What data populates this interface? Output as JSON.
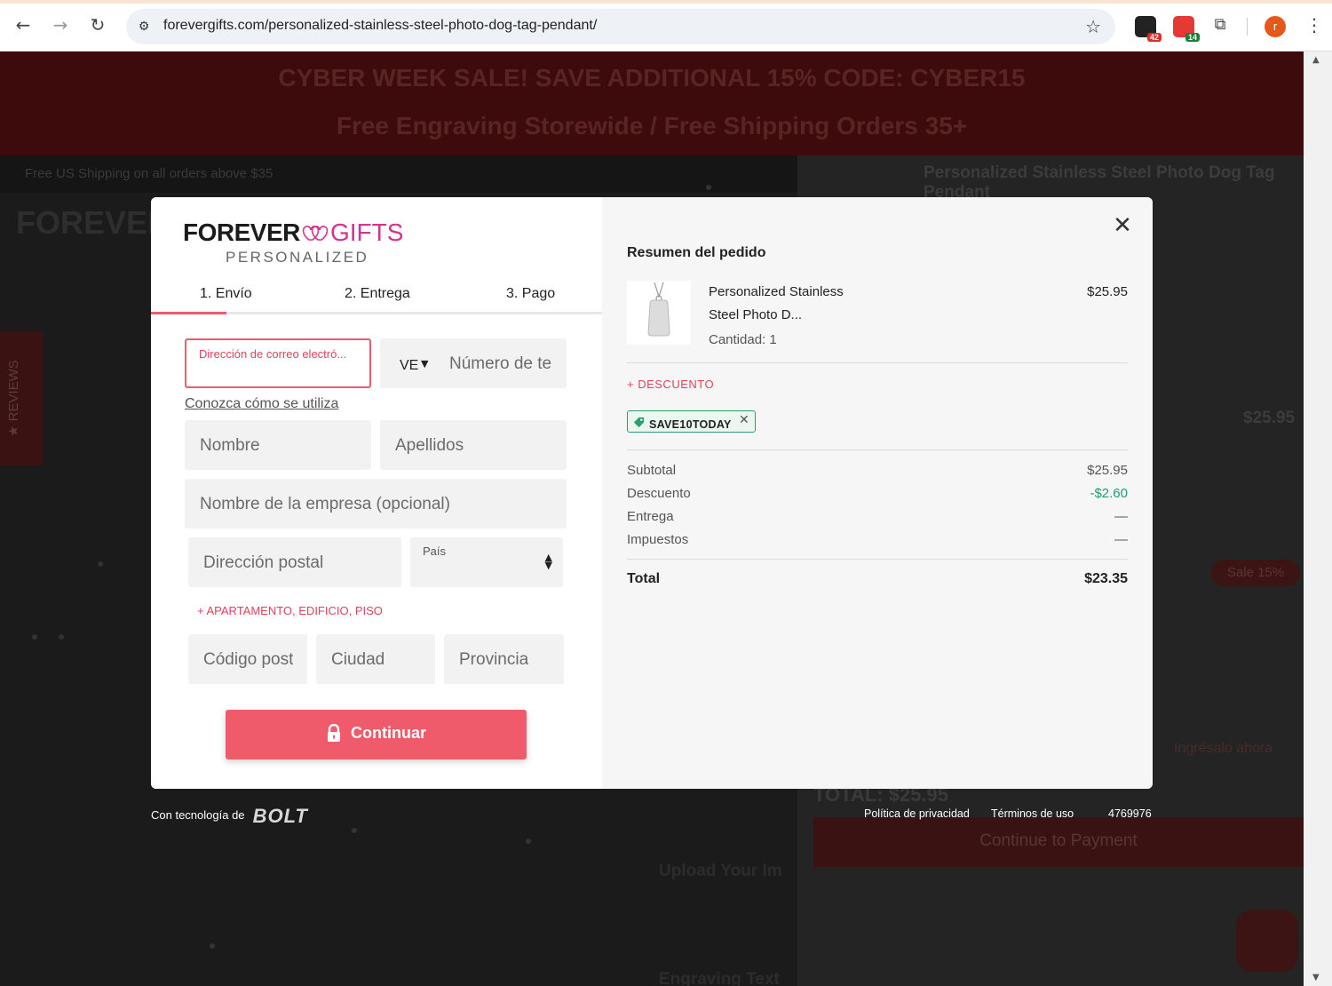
{
  "browser": {
    "url": "forevergifts.com/personalized-stainless-steel-photo-dog-tag-pendant/",
    "ext_badge_1": "42",
    "ext_badge_2": "14",
    "profile_initial": "r"
  },
  "background": {
    "promo_line1": "CYBER WEEK SALE! SAVE ADDITIONAL 15% CODE: CYBER15",
    "promo_line2": "Free Engraving Storewide / Free Shipping Orders 35+",
    "shipping_note": "Free US Shipping on all orders above $35",
    "header_product_title": "Personalized Stainless Steel Photo Dog Tag Pendant",
    "reviews_tab": "★ REVIEWS",
    "bg_price": "$25.95",
    "bg_total": "TOTAL: $25.95",
    "continue_payment": "Continue to Payment",
    "upload_label": "Upload Your Im",
    "engraving_label": "Engraving Text",
    "sale_badge": "Sale 15%",
    "ingresalo": "Ingrésalo ahora"
  },
  "modal": {
    "logo": {
      "forever": "FOREVER",
      "gifts": "GIFTS",
      "personalized": "PERSONALIZED"
    },
    "steps": [
      {
        "label": "1. Envío",
        "active": true
      },
      {
        "label": "2. Entrega",
        "active": false
      },
      {
        "label": "3. Pago",
        "active": false
      }
    ],
    "form": {
      "email_label": "Dirección de correo electró...",
      "phone_country": "VE",
      "phone_placeholder": "Número de te",
      "know_link": "Conozca cómo se utiliza",
      "first_name": "Nombre",
      "last_name": "Apellidos",
      "company": "Nombre de la empresa (opcional)",
      "address": "Dirección postal",
      "country_label": "País",
      "apartment_link": "+ APARTAMENTO, EDIFICIO, PISO",
      "postal_code": "Código post",
      "city": "Ciudad",
      "province": "Provincia",
      "continue_label": "Continuar"
    },
    "summary": {
      "title": "Resumen del pedido",
      "product_name_line1": "Personalized Stainless",
      "product_name_line2": "Steel Photo D...",
      "quantity": "Cantidad: 1",
      "product_price": "$25.95",
      "discount_link": "+ DESCUENTO",
      "coupon_code": "SAVE10TODAY",
      "rows": [
        {
          "label": "Subtotal",
          "value": "$25.95"
        },
        {
          "label": "Descuento",
          "value": "-$2.60"
        },
        {
          "label": "Entrega",
          "value": "—"
        },
        {
          "label": "Impuestos",
          "value": "—"
        }
      ],
      "total_label": "Total",
      "total_value": "$23.35"
    }
  },
  "footer": {
    "powered_by": "Con tecnología de",
    "brand": "BOLT",
    "privacy": "Política de privacidad",
    "terms": "Términos de uso",
    "ref_id": "4769976"
  },
  "colors": {
    "accent": "#f05b6b",
    "brand_pink": "#d6338a",
    "discount_green": "#19a26a",
    "promo_bg": "#3d0b0b"
  }
}
